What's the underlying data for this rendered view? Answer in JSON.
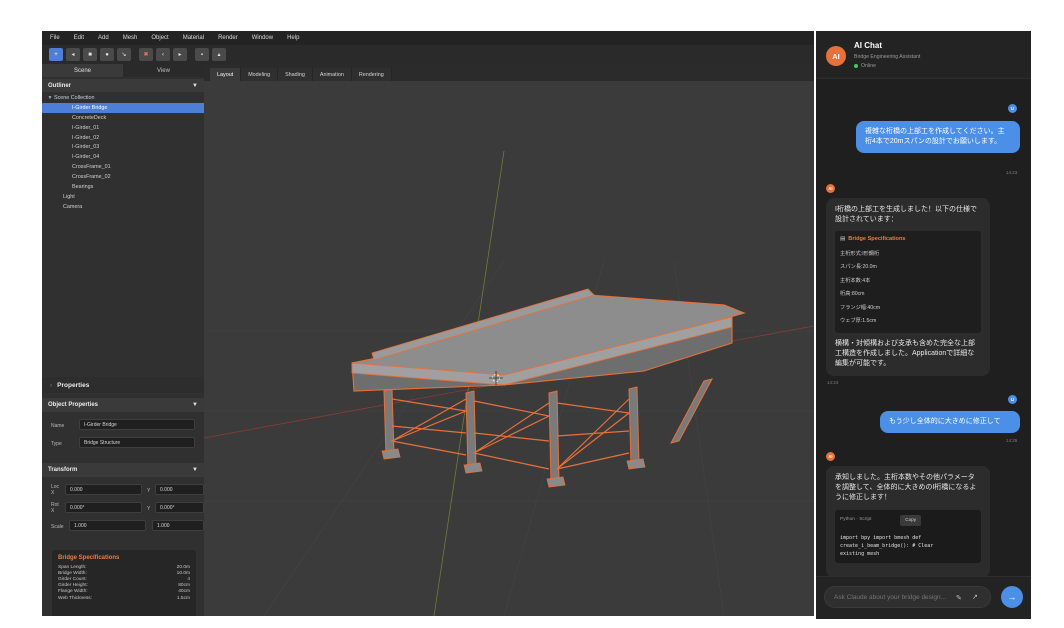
{
  "menu": [
    "File",
    "Edit",
    "Add",
    "Mesh",
    "Object",
    "Material",
    "Render",
    "Window",
    "Help"
  ],
  "toolbar": {
    "buttons": [
      {
        "icon": "+",
        "icon_name": "add-icon",
        "active": true
      },
      {
        "icon": "◂",
        "icon_name": "move-icon",
        "active": false
      },
      {
        "icon": "■",
        "icon_name": "cube-icon",
        "active": false
      },
      {
        "icon": "●",
        "icon_name": "sphere-icon",
        "active": false
      },
      {
        "icon": "↘",
        "icon_name": "arrow-icon",
        "active": false
      },
      {
        "icon": "✖",
        "icon_name": "delete-icon",
        "active": false,
        "warn": true
      },
      {
        "icon": "‹",
        "icon_name": "undo-icon",
        "active": false
      },
      {
        "icon": "▸",
        "icon_name": "redo-icon",
        "active": false
      },
      {
        "icon": "▪",
        "icon_name": "render-icon",
        "active": false
      },
      {
        "icon": "▴",
        "icon_name": "export-icon",
        "active": false
      }
    ]
  },
  "scene_tabs": [
    "Scene",
    "View"
  ],
  "outliner": {
    "title": "Outliner",
    "items": [
      {
        "label": "Scene Collection",
        "indent": 0,
        "expander": "▼",
        "selected": false
      },
      {
        "label": "I-Girder Bridge",
        "indent": 2,
        "expander": "",
        "selected": true
      },
      {
        "label": "ConcreteDeck",
        "indent": 2,
        "expander": "",
        "selected": false
      },
      {
        "label": "I-Girder_01",
        "indent": 2,
        "expander": "",
        "selected": false
      },
      {
        "label": "I-Girder_02",
        "indent": 2,
        "expander": "",
        "selected": false
      },
      {
        "label": "I-Girder_03",
        "indent": 2,
        "expander": "",
        "selected": false
      },
      {
        "label": "I-Girder_04",
        "indent": 2,
        "expander": "",
        "selected": false
      },
      {
        "label": "CrossFrame_01",
        "indent": 2,
        "expander": "",
        "selected": false
      },
      {
        "label": "CrossFrame_02",
        "indent": 2,
        "expander": "",
        "selected": false
      },
      {
        "label": "Bearings",
        "indent": 2,
        "expander": "",
        "selected": false
      },
      {
        "label": "Light",
        "indent": 1,
        "expander": "",
        "selected": false
      },
      {
        "label": "Camera",
        "indent": 1,
        "expander": "",
        "selected": false
      }
    ]
  },
  "properties": {
    "title": "Properties",
    "object_title": "Object Properties",
    "name_label": "Name",
    "name_value": "I-Girder Bridge",
    "type_label": "Type",
    "type_value": "Bridge Structure"
  },
  "transform": {
    "title": "Transform",
    "loc_label": "Loc X",
    "loc_x": "0.000",
    "loc_y_label": "Y",
    "loc_y": "0.000",
    "rot_label": "Rot X",
    "rot_x": "0.000°",
    "rot_y_label": "Y",
    "rot_y": "0.000°",
    "scale_label": "Scale",
    "scale_x": "1.000",
    "scale_y": "1.000"
  },
  "bridge_specs": {
    "title": "Bridge Specifications",
    "rows": [
      {
        "label": "Span Length:",
        "value": "20.0m"
      },
      {
        "label": "Bridge Width:",
        "value": "10.0m"
      },
      {
        "label": "Girder Count:",
        "value": "4"
      },
      {
        "label": "Girder Height:",
        "value": "80cm"
      },
      {
        "label": "Flange Width:",
        "value": "40cm"
      },
      {
        "label": "Web Thickness:",
        "value": "1.5cm"
      }
    ]
  },
  "view_tabs": [
    "Layout",
    "Modeling",
    "Shading",
    "Animation",
    "Rendering"
  ],
  "colors": {
    "accent_blue": "#4b8fe6",
    "accent_orange": "#e8703a",
    "online_green": "#3ccf5e",
    "selection_outline": "#e8703a"
  },
  "chat": {
    "title": "AI Chat",
    "subtitle": "Bridge Engineering Assistant",
    "status": "Online",
    "avatar": "AI",
    "user_avatar": "U",
    "msg1": "複雑な桁橋の上部工を作成してください。主桁4本で20mスパンの設計でお願いします。",
    "msg1_time": "14:23",
    "msg2_intro": "I桁橋の上部工を生成しました！以下の仕様で設計されています：",
    "msg2_spec_title": "Bridge Specifications",
    "msg2_spec_items": [
      "主桁形式:I形鋼桁",
      "スパン長:20.0m",
      "主桁本数:4本",
      "桁高:80cm",
      "フランジ幅:40cm",
      "ウェブ厚:1.5cm"
    ],
    "msg2_outro": "横構・対傾構および支承も含めた完全な上部工構造を作成しました。Applicationで詳細な編集が可能です。",
    "msg2_time": "14:24",
    "msg3": "もう少し全体的に大きめに修正して",
    "msg3_time": "14:25",
    "msg4": "承知しました。主桁本数やその他パラメータを調整して、全体的に大きめのI桁橋になるように修正します！",
    "code_lang": "Python · Script",
    "code_copy": "Copy",
    "code": "import bpy import bmesh def\ncreate_i_beam_bridge(): # Clear\nexisting mesh",
    "input_placeholder": "Ask Claude about your bridge design...",
    "attach_icon": "✎",
    "wand_icon": "↗",
    "send_icon": "→"
  }
}
